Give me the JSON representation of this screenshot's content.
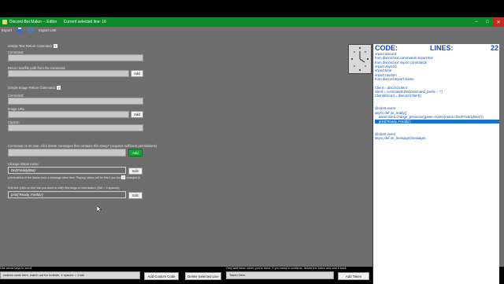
{
  "window": {
    "title": "Discord Bot Maker -- Editor      Current selected line: 16",
    "controls": [
      "–",
      "□",
      "✕"
    ]
  },
  "menu": {
    "items": [
      "Export",
      "Import Link"
    ]
  },
  "left": {
    "text_command_label": "Simple Text Return Command",
    "command_label": "Command:",
    "command_value": "",
    "message_label": "Return text/file path from the command:",
    "message_value": "",
    "add_label": "Add",
    "image_command_label": "Simple Image Return Command",
    "image_command_field_label": "Command:",
    "image_command_value": "",
    "image_url_label": "Image URL:",
    "image_url_value": "",
    "caption_label": "Caption:",
    "caption_value": "",
    "delete_label": "Command on its own, click delete messages that contains this string? (requires sufficient permissions)",
    "delete_value": "",
    "status_label": "Change status name:",
    "status_value": "DeZFreddy(Bot)",
    "status_hint": "(retrieval/bot of the status once a message other then 'Playing' status will be this if you haven't changed it)",
    "edit_label": "Edit",
    "edit_line_label": "Edit line (click on the line you want to edit) Warnings or indentation (Tab = 4 spaces):",
    "edit_line_value": "print('Ready, Freddy')",
    "edit2_label": "Edit"
  },
  "bottom": {
    "custom_label": "Use arrow keys to scroll",
    "custom_value": "custom code here, watch out for Indents. 4 spaces = 1 tab",
    "add_custom_label": "Add Custom Code",
    "delete_line_label": "Delete Selected Line",
    "token_label": "Only add token when you're done, if you need to continue, delete the token and add it back",
    "token_value": "Token Here",
    "add_token_label": "Add Token"
  },
  "code": {
    "header": "CODE:",
    "lines_label": "LINES:",
    "lines_count": "22",
    "lines": [
      "import discord",
      "from discord.ext.commands import Bot",
      "from discord.ext import commands",
      "import asyncio",
      "import time",
      "import random",
      "from discord import Game",
      "",
      "Client = discord.client",
      "client = commands.Bot(command_prefix = '!')",
      "Clientdiscord = discord.Client()",
      "",
      "",
      "@client.event",
      "async def on_ready():",
      "    await client.change_presence(game=Game(name='DeZFreddy(Bot)'))",
      "    print('Ready, Freddy')",
      "",
      "",
      "@client.event",
      "async def on_message(message):",
      ""
    ],
    "selected_index": 16
  }
}
